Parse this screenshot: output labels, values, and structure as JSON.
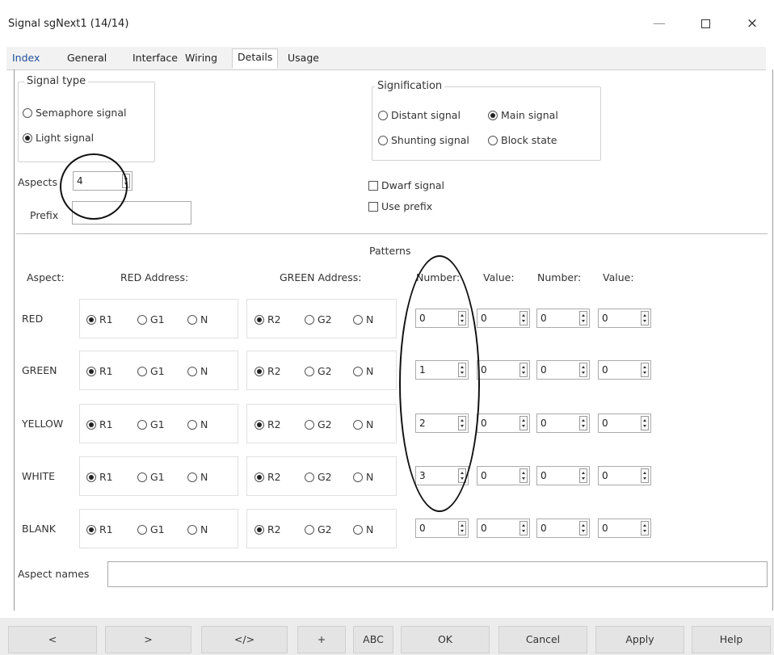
{
  "window": {
    "title": "Signal sgNext1 (14/14)",
    "controls": {
      "minimize": "—",
      "close": "×"
    }
  },
  "tabs": [
    {
      "label": "Index"
    },
    {
      "label": "General"
    },
    {
      "label": "Interface"
    },
    {
      "label": "Wiring"
    },
    {
      "label": "Details",
      "active": true
    },
    {
      "label": "Usage"
    }
  ],
  "signal_type": {
    "caption": "Signal type",
    "options": [
      {
        "label": "Semaphore signal",
        "checked": false
      },
      {
        "label": "Light signal",
        "checked": true
      }
    ]
  },
  "signification": {
    "caption": "Signification",
    "options": [
      {
        "label": "Distant signal",
        "checked": false
      },
      {
        "label": "Main signal",
        "checked": true
      },
      {
        "label": "Shunting signal",
        "checked": false
      },
      {
        "label": "Block state",
        "checked": false
      }
    ]
  },
  "aspects": {
    "label": "Aspects",
    "value": "4"
  },
  "prefix": {
    "label": "Prefix",
    "value": ""
  },
  "checks": {
    "dwarf": {
      "label": "Dwarf signal",
      "checked": false
    },
    "use_prefix": {
      "label": "Use prefix",
      "checked": false
    }
  },
  "patterns": {
    "title": "Patterns",
    "headers": {
      "aspect": "Aspect:",
      "red_address": "RED Address:",
      "green_address": "GREEN Address:",
      "number1": "Number:",
      "value1": "Value:",
      "number2": "Number:",
      "value2": "Value:"
    },
    "rows": [
      {
        "aspect": "RED",
        "red": [
          {
            "label": "R1",
            "on": true
          },
          {
            "label": "G1",
            "on": false
          },
          {
            "label": "N",
            "on": false
          }
        ],
        "green": [
          {
            "label": "R2",
            "on": true
          },
          {
            "label": "G2",
            "on": false
          },
          {
            "label": "N",
            "on": false
          }
        ],
        "spins": [
          "0",
          "0",
          "0",
          "0"
        ]
      },
      {
        "aspect": "GREEN",
        "red": [
          {
            "label": "R1",
            "on": true
          },
          {
            "label": "G1",
            "on": false
          },
          {
            "label": "N",
            "on": false
          }
        ],
        "green": [
          {
            "label": "R2",
            "on": true
          },
          {
            "label": "G2",
            "on": false
          },
          {
            "label": "N",
            "on": false
          }
        ],
        "spins": [
          "1",
          "0",
          "0",
          "0"
        ]
      },
      {
        "aspect": "YELLOW",
        "red": [
          {
            "label": "R1",
            "on": true
          },
          {
            "label": "G1",
            "on": false
          },
          {
            "label": "N",
            "on": false
          }
        ],
        "green": [
          {
            "label": "R2",
            "on": true
          },
          {
            "label": "G2",
            "on": false
          },
          {
            "label": "N",
            "on": false
          }
        ],
        "spins": [
          "2",
          "0",
          "0",
          "0"
        ]
      },
      {
        "aspect": "WHITE",
        "red": [
          {
            "label": "R1",
            "on": true
          },
          {
            "label": "G1",
            "on": false
          },
          {
            "label": "N",
            "on": false
          }
        ],
        "green": [
          {
            "label": "R2",
            "on": true
          },
          {
            "label": "G2",
            "on": false
          },
          {
            "label": "N",
            "on": false
          }
        ],
        "spins": [
          "3",
          "0",
          "0",
          "0"
        ]
      },
      {
        "aspect": "BLANK",
        "red": [
          {
            "label": "R1",
            "on": true
          },
          {
            "label": "G1",
            "on": false
          },
          {
            "label": "N",
            "on": false
          }
        ],
        "green": [
          {
            "label": "R2",
            "on": true
          },
          {
            "label": "G2",
            "on": false
          },
          {
            "label": "N",
            "on": false
          }
        ],
        "spins": [
          "0",
          "0",
          "0",
          "0"
        ]
      }
    ]
  },
  "aspect_names": {
    "label": "Aspect names",
    "value": ""
  },
  "buttons": [
    {
      "label": "<"
    },
    {
      "label": ">"
    },
    {
      "label": "</>"
    },
    {
      "label": "+"
    },
    {
      "label": "ABC"
    },
    {
      "label": "OK"
    },
    {
      "label": "Cancel"
    },
    {
      "label": "Apply"
    },
    {
      "label": "Help"
    }
  ]
}
